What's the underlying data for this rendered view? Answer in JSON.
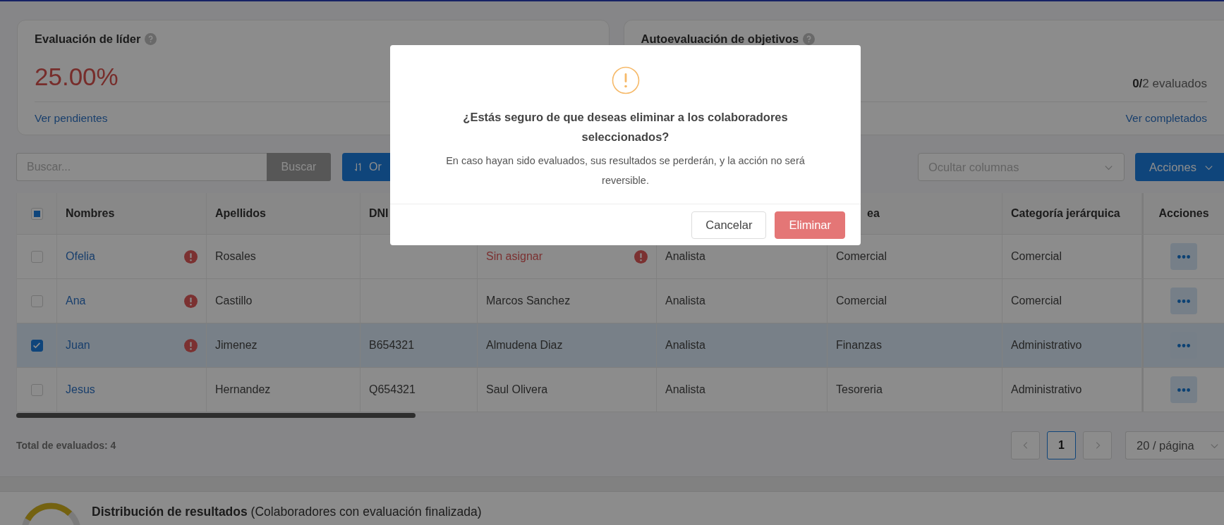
{
  "cards": [
    {
      "title": "Evaluación de líder",
      "value": "25.00%",
      "link": "Ver pendientes"
    },
    {
      "title": "Autoevaluación de objetivos",
      "count": "**0/**2 evaluados",
      "link": "Ver completados"
    }
  ],
  "toolbar": {
    "search": {
      "placeholder": "Buscar..."
    },
    "search_button": "Buscar",
    "sort_button": "Or",
    "columns_select": {
      "placeholder": "Ocultar columnas"
    },
    "actions_button": "Acciones"
  },
  "table": {
    "select_all": {
      "indeterminate": true
    },
    "columns": [
      {
        "label": "Nombres"
      },
      {
        "label": "Apellidos"
      },
      {
        "label": "DNI"
      },
      {},
      {},
      {
        "label": "ea"
      },
      {
        "label": "Categoría jerárquica"
      },
      {
        "label": "Acciones"
      }
    ],
    "rows": [
      {
        "checked": false,
        "nombres": "Ofelia",
        "alert": true,
        "apellidos": "Rosales",
        "column_4": {
          "text": "Sin asignar",
          "alert": true
        },
        "column_5": "Analista",
        "area": "Comercial",
        "categoria": "Comercial"
      },
      {
        "checked": false,
        "nombres": "Ana",
        "alert": true,
        "apellidos": "Castillo",
        "column_4": {
          "text": "Marcos Sanchez",
          "alert": false
        },
        "column_5": "Analista",
        "area": "Comercial",
        "categoria": "Comercial"
      },
      {
        "checked": true,
        "nombres": "Juan",
        "alert": true,
        "apellidos": "Jimenez",
        "dni": "B654321",
        "column_4": {
          "text": "Almudena Diaz",
          "alert": false
        },
        "column_5": "Analista",
        "area": "Finanzas",
        "categoria": "Administrativo"
      },
      {
        "checked": false,
        "nombres": "Jesus",
        "alert": false,
        "apellidos": "Hernandez",
        "dni": "Q654321",
        "column_4": {
          "text": "Saul Olivera",
          "alert": false
        },
        "column_5": "Analista",
        "area": "Tesoreria",
        "categoria": "Administrativo"
      }
    ]
  },
  "total": "Total de evaluados: 4",
  "pagination": {
    "pages": [
      {
        "label": "1",
        "selected": true
      }
    ],
    "page_size": "20 / página"
  },
  "distribution": {
    "heading": "**Distribución de resultados** (Colaboradores con evaluación finalizada)"
  },
  "dialog": {
    "title": "¿Estás seguro de que deseas eliminar a los colaboradores seleccionados?",
    "message": "En caso hayan sido evaluados, sus resultados se perderán, y la acción no será reversible.",
    "buttons": [
      {
        "label": "Cancelar",
        "kind": "secondary"
      },
      {
        "label": "Eliminar",
        "kind": "danger"
      }
    ]
  }
}
